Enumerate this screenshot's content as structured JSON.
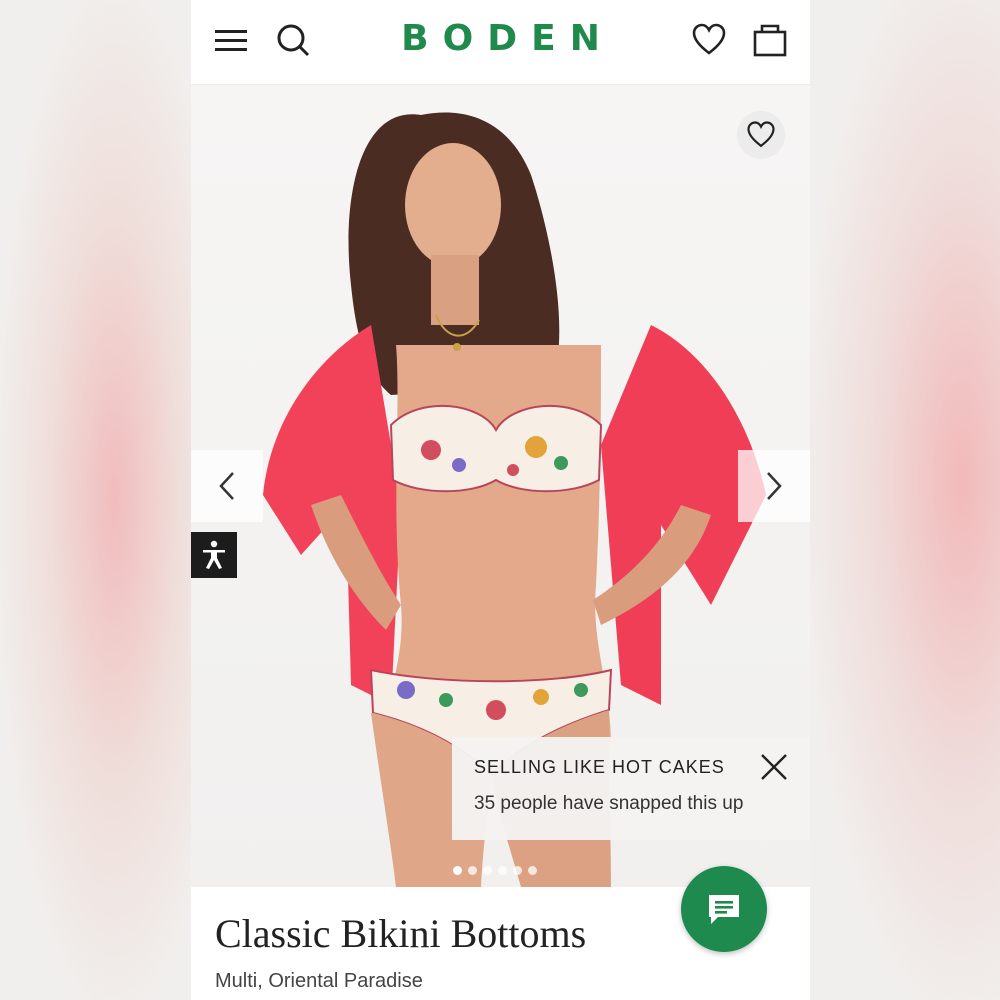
{
  "header": {
    "logo": "BODEN",
    "menu_icon": "menu-icon",
    "search_icon": "search-icon",
    "wishlist_icon": "heart-icon",
    "bag_icon": "bag-icon"
  },
  "gallery": {
    "image_count": 6,
    "active_index": 0
  },
  "popup": {
    "title": "SELLING LIKE HOT CAKES",
    "text": "35 people have snapped this up"
  },
  "product": {
    "title": "Classic Bikini Bottoms",
    "subtitle": "Multi, Oriental Paradise"
  },
  "colors": {
    "brand": "#1f8a4c",
    "chat": "#1e8a4e",
    "shirt": "#f2425a"
  }
}
